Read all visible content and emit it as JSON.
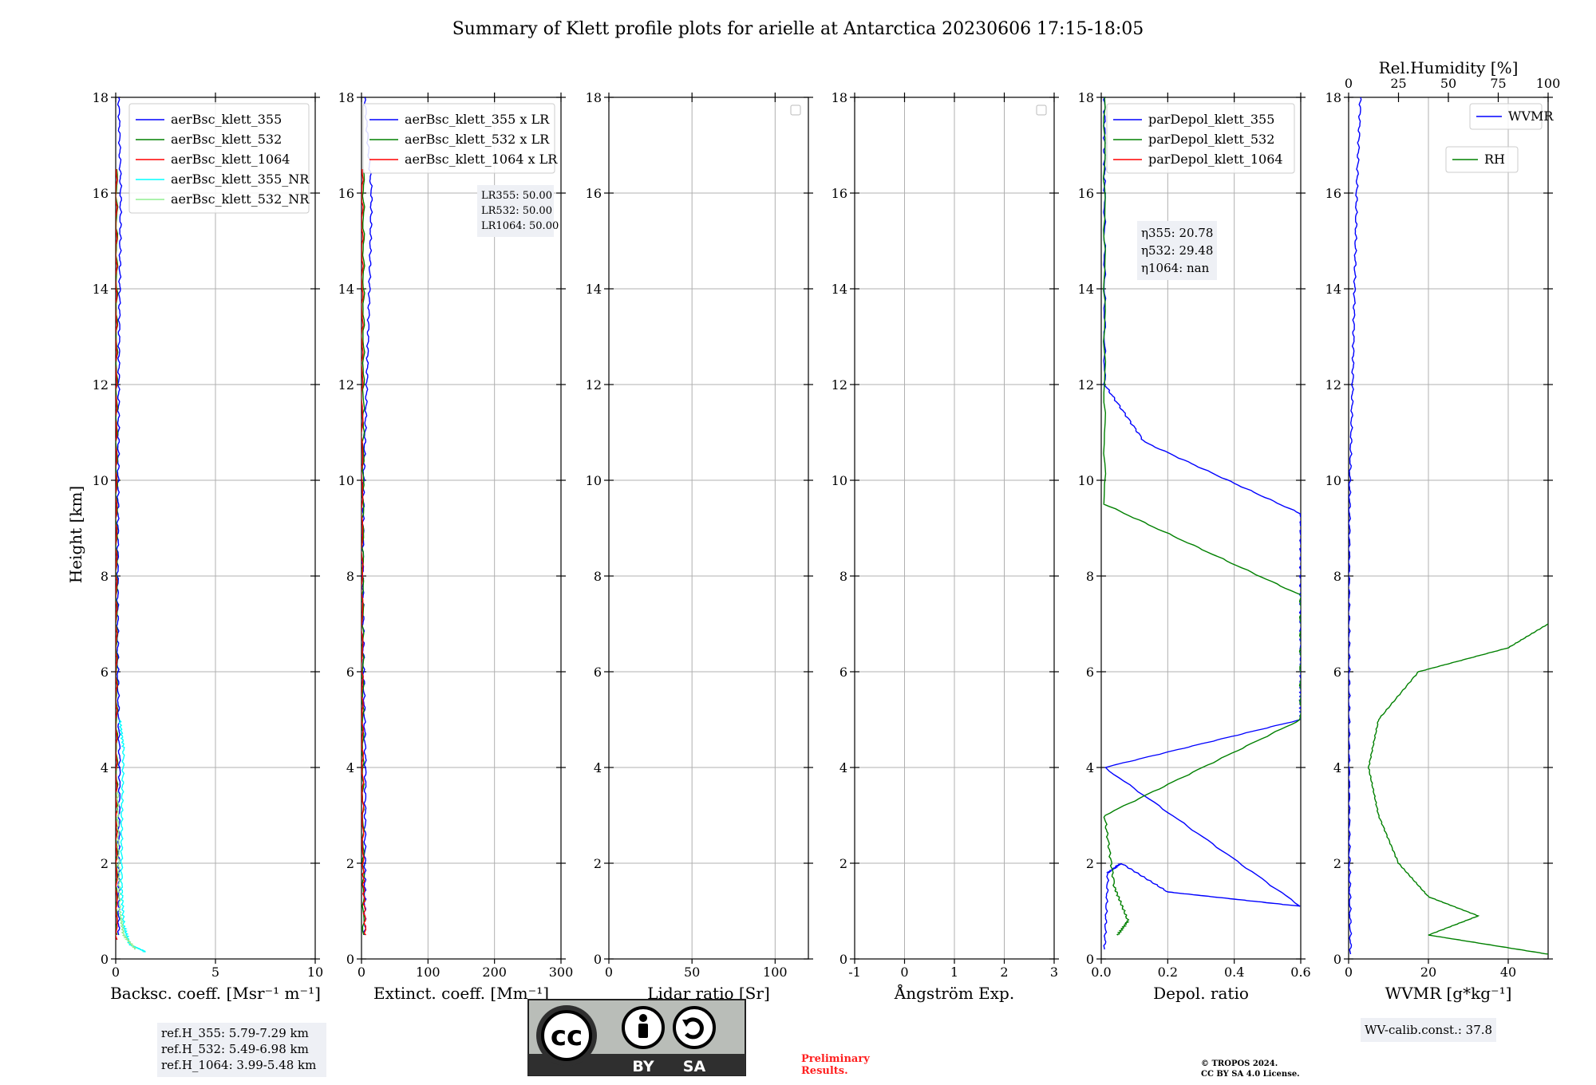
{
  "title": "Summary of Klett profile plots for arielle at Antarctica 20230606 17:15-18:05",
  "ylabel": "Height [km]",
  "colors": {
    "blue": "#0000ff",
    "green": "#008000",
    "red": "#ff0000",
    "cyan": "#00ffff",
    "lightgreen": "#90ee90"
  },
  "chart_data": [
    {
      "type": "line",
      "xlabel": "Backsc. coeff. [Msr⁻¹ m⁻¹]",
      "xlim": [
        0,
        10
      ],
      "xticks": [
        0,
        5,
        10
      ],
      "ylim": [
        0,
        18
      ],
      "yticks": [
        0,
        2,
        4,
        6,
        8,
        10,
        12,
        14,
        16,
        18
      ],
      "grid": true,
      "legend_position": "top-right",
      "series": [
        {
          "name": "aerBsc_klett_355",
          "color": "#0000ff",
          "profile": [
            [
              0.15,
              0.5
            ],
            [
              0.15,
              2
            ],
            [
              0.2,
              4
            ],
            [
              0.1,
              6
            ],
            [
              0.1,
              8
            ],
            [
              0.12,
              10
            ],
            [
              0.15,
              12
            ],
            [
              0.2,
              14
            ],
            [
              0.25,
              16
            ],
            [
              0.15,
              18
            ]
          ]
        },
        {
          "name": "aerBsc_klett_532",
          "color": "#008000",
          "profile": [
            [
              0.05,
              0.5
            ],
            [
              0.05,
              4
            ],
            [
              0.05,
              8
            ],
            [
              0.05,
              12
            ],
            [
              0.05,
              16.5
            ]
          ]
        },
        {
          "name": "aerBsc_klett_1064",
          "color": "#ff0000",
          "profile": [
            [
              0.05,
              0.4
            ],
            [
              0.02,
              4
            ],
            [
              0.02,
              8
            ],
            [
              0.02,
              12
            ],
            [
              0.02,
              16.5
            ]
          ]
        },
        {
          "name": "aerBsc_klett_355_NR",
          "color": "#00ffff",
          "profile": [
            [
              1.5,
              0.15
            ],
            [
              0.7,
              0.3
            ],
            [
              0.4,
              0.7
            ],
            [
              0.3,
              1.5
            ],
            [
              0.3,
              3
            ],
            [
              0.4,
              4.4
            ],
            [
              0.2,
              5
            ]
          ]
        },
        {
          "name": "aerBsc_klett_532_NR",
          "color": "#90ee90",
          "profile": [
            [
              1.0,
              0.2
            ],
            [
              0.4,
              0.5
            ],
            [
              0.2,
              1
            ],
            [
              0.15,
              2
            ],
            [
              0.1,
              3.5
            ]
          ]
        }
      ],
      "info": [
        "ref.H_355: 5.79-7.29 km",
        "ref.H_532: 5.49-6.98 km",
        "ref.H_1064: 3.99-5.48 km"
      ]
    },
    {
      "type": "line",
      "xlabel": "Extinct. coeff. [Mm⁻¹]",
      "xlim": [
        0,
        300
      ],
      "xticks": [
        0,
        100,
        200,
        300
      ],
      "ylim": [
        0,
        18
      ],
      "yticks": [
        0,
        2,
        4,
        6,
        8,
        10,
        12,
        14,
        16,
        18
      ],
      "grid": true,
      "legend_position": "top-right",
      "series": [
        {
          "name": "aerBsc_klett_355 x LR",
          "color": "#0000ff",
          "profile": [
            [
              5,
              0.5
            ],
            [
              5,
              2
            ],
            [
              6,
              4
            ],
            [
              3,
              6
            ],
            [
              2,
              8
            ],
            [
              3,
              10
            ],
            [
              8,
              12
            ],
            [
              12,
              14
            ],
            [
              15,
              16
            ],
            [
              5,
              18
            ]
          ]
        },
        {
          "name": "aerBsc_klett_532 x LR",
          "color": "#008000",
          "profile": [
            [
              3,
              0.5
            ],
            [
              2,
              4
            ],
            [
              2,
              8
            ],
            [
              3,
              12
            ],
            [
              3,
              16.5
            ]
          ]
        },
        {
          "name": "aerBsc_klett_1064 x LR",
          "color": "#ff0000",
          "profile": [
            [
              6,
              0.5
            ],
            [
              2,
              2
            ],
            [
              1,
              6
            ],
            [
              1,
              12
            ],
            [
              1,
              16.5
            ]
          ]
        }
      ],
      "info": [
        "LR355: 50.00",
        "LR532: 50.00",
        "LR1064: 50.00"
      ]
    },
    {
      "type": "line",
      "xlabel": "Lidar ratio [Sr]",
      "xlim": [
        0,
        120
      ],
      "xticks": [
        0,
        50,
        100
      ],
      "ylim": [
        0,
        18
      ],
      "yticks": [
        0,
        2,
        4,
        6,
        8,
        10,
        12,
        14,
        16,
        18
      ],
      "grid": true,
      "series": []
    },
    {
      "type": "line",
      "xlabel": "Ångström Exp.",
      "xlim": [
        -1,
        3
      ],
      "xticks": [
        -1,
        0,
        1,
        2,
        3
      ],
      "ylim": [
        0,
        18
      ],
      "yticks": [
        0,
        2,
        4,
        6,
        8,
        10,
        12,
        14,
        16,
        18
      ],
      "grid": true,
      "series": []
    },
    {
      "type": "line",
      "xlabel": "Depol. ratio",
      "xlim": [
        0,
        0.6
      ],
      "xticks": [
        "0.0",
        "0.2",
        "0.4",
        "0.6"
      ],
      "ylim": [
        0,
        18
      ],
      "yticks": [
        0,
        2,
        4,
        6,
        8,
        10,
        12,
        14,
        16,
        18
      ],
      "grid": true,
      "legend_position": "top-right",
      "series": [
        {
          "name": "parDepol_klett_355",
          "color": "#0000ff",
          "profile": [
            [
              0.01,
              0.2
            ],
            [
              0.02,
              1.8
            ],
            [
              0.06,
              2
            ],
            [
              0.2,
              1.4
            ],
            [
              0.6,
              1.1
            ],
            [
              0.01,
              4
            ],
            [
              0.6,
              5
            ],
            [
              0.6,
              5.6
            ],
            [
              0.6,
              6.5
            ],
            [
              0.6,
              7.9
            ],
            [
              0.6,
              9.3
            ],
            [
              0.13,
              10.8
            ],
            [
              0.01,
              12
            ],
            [
              0.01,
              16
            ],
            [
              0.01,
              18
            ]
          ]
        },
        {
          "name": "parDepol_klett_532",
          "color": "#008000",
          "profile": [
            [
              0.05,
              0.5
            ],
            [
              0.08,
              0.8
            ],
            [
              0.04,
              1.5
            ],
            [
              0.01,
              3
            ],
            [
              0.6,
              5
            ],
            [
              0.6,
              7.6
            ],
            [
              0.01,
              9.5
            ],
            [
              0.01,
              18
            ]
          ]
        },
        {
          "name": "parDepol_klett_1064",
          "color": "#ff0000",
          "profile": []
        }
      ],
      "info": [
        "η355: 20.78",
        "η532: 29.48",
        "η1064: nan"
      ]
    },
    {
      "type": "line",
      "xlabel": "WVMR [g*kg⁻¹]",
      "xlim": [
        0,
        50
      ],
      "xticks": [
        0,
        20,
        40
      ],
      "x2label": "Rel.Humidity [%]",
      "x2lim": [
        0,
        100
      ],
      "x2ticks": [
        0,
        25,
        50,
        75,
        100
      ],
      "ylim": [
        0,
        18
      ],
      "yticks": [
        0,
        2,
        4,
        6,
        8,
        10,
        12,
        14,
        16,
        18
      ],
      "grid": true,
      "series": [
        {
          "name": "WVMR",
          "color": "#0000ff",
          "profile": [
            [
              0.5,
              0.1
            ],
            [
              0.2,
              2
            ],
            [
              0.1,
              4
            ],
            [
              0.1,
              6
            ],
            [
              0.1,
              8
            ],
            [
              0.3,
              10
            ],
            [
              1,
              12
            ],
            [
              1.5,
              14
            ],
            [
              2,
              16
            ],
            [
              3,
              18
            ]
          ]
        },
        {
          "name": "RH",
          "color": "#008000",
          "axis": "x2",
          "profile": [
            [
              100,
              0.1
            ],
            [
              40,
              0.5
            ],
            [
              65,
              0.9
            ],
            [
              40,
              1.3
            ],
            [
              25,
              2
            ],
            [
              15,
              3
            ],
            [
              10,
              4
            ],
            [
              15,
              5
            ],
            [
              35,
              6
            ],
            [
              80,
              6.5
            ],
            [
              100,
              7
            ]
          ]
        }
      ],
      "info": [
        "WV-calib.const.: 37.8"
      ]
    }
  ],
  "license": {
    "cc": "cc",
    "by": "BY",
    "sa": "SA"
  },
  "footer": {
    "preliminary_line1": "Preliminary",
    "preliminary_line2": "Results.",
    "copyright_line1": "© TROPOS 2024.",
    "copyright_line2": "CC BY SA 4.0 License."
  }
}
